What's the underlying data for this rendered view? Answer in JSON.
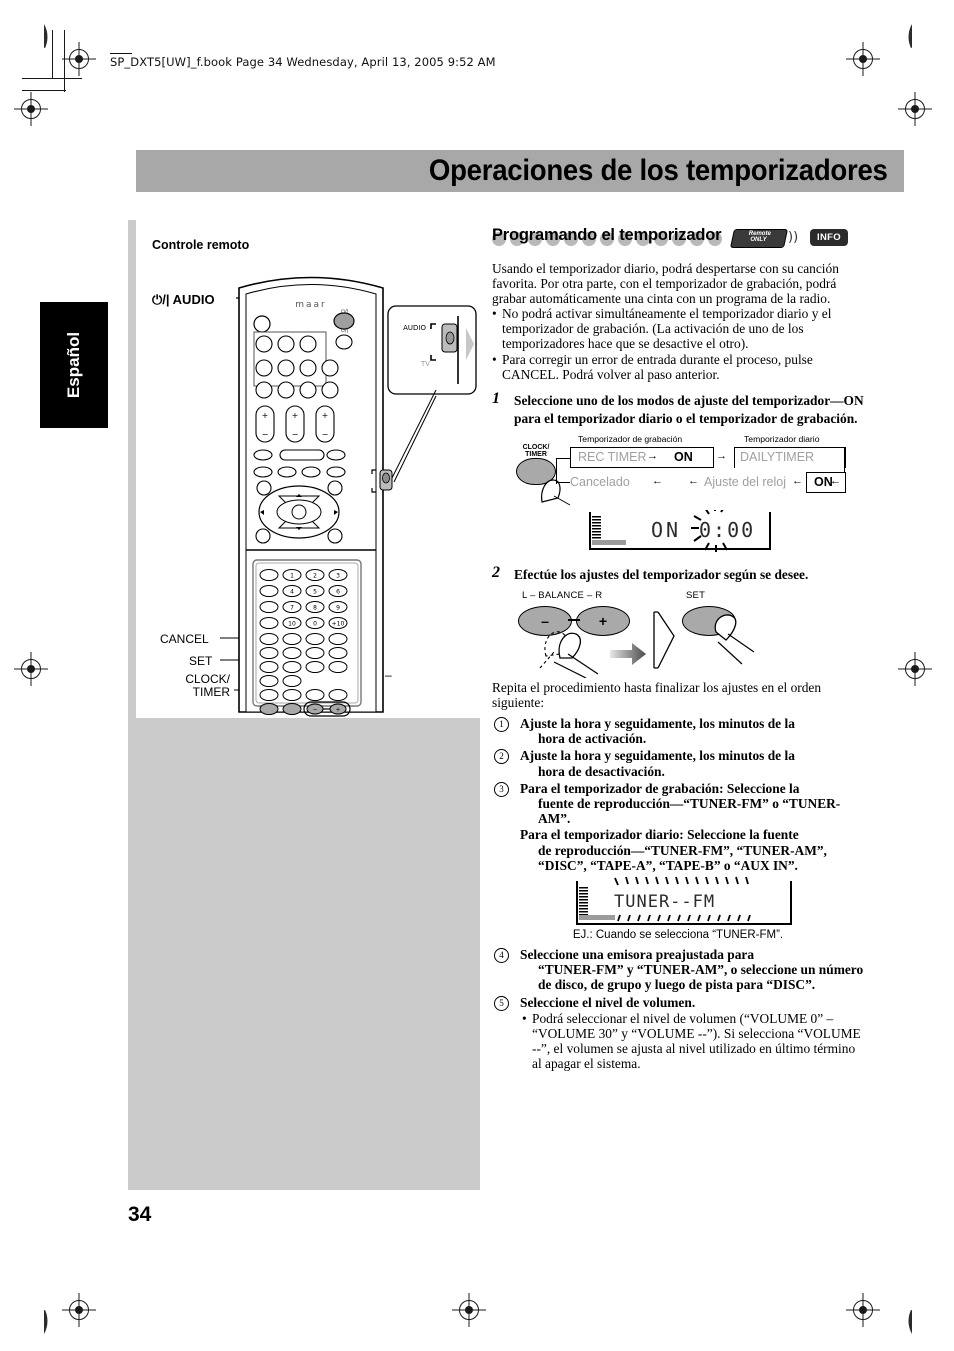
{
  "header": {
    "file_line": "SP_DXT5[UW]_f.book  Page 34  Wednesday, April 13, 2005  9:52 AM"
  },
  "page": {
    "title": "Operaciones de los temporizadores",
    "number": "34",
    "language_tab": "Español"
  },
  "left_panel": {
    "caption": "Controle remoto",
    "brand": "maar",
    "callouts": {
      "power_audio": "⏻/| AUDIO",
      "cancel": "CANCEL",
      "set": "SET",
      "clock_timer": "CLOCK/\nTIMER",
      "clock_timer_l1": "CLOCK/",
      "clock_timer_l2": "TIMER",
      "plus_minus": "+ / –"
    },
    "inset": {
      "audio": "AUDIO",
      "tv": "TV"
    },
    "keypad": [
      "1",
      "2",
      "3",
      "4",
      "5",
      "6",
      "7",
      "8",
      "9",
      "10",
      "0",
      "+10"
    ]
  },
  "section": {
    "heading": "Programando el temporizador",
    "badge_remote_l1": "Remote",
    "badge_remote_l2": "ONLY",
    "badge_info": "INFO",
    "intro": "Usando el temporizador diario, podrá despertarse con su canción favorita. Por otra parte, con el temporizador de grabación, podrá grabar automáticamente una cinta con un programa de la radio.",
    "bullets": [
      "No podrá activar simultáneamente el temporizador diario y el temporizador de grabación. (La activación de uno de los temporizadores hace que se desactive el otro).",
      "Para corregir un error de entrada durante el proceso, pulse CANCEL. Podrá volver al paso anterior."
    ]
  },
  "steps": {
    "one": {
      "num": "1",
      "text": "Seleccione uno de los modos de ajuste del temporizador—ON para el temporizador diario o el temporizador de grabación."
    },
    "two": {
      "num": "2",
      "text": "Efectúe los ajustes del temporizador según se desee."
    }
  },
  "flow": {
    "button_l1": "CLOCK/",
    "button_l2": "TIMER",
    "label_rec": "Temporizador de grabación",
    "label_daily": "Temporizador diario",
    "rec_timer": "REC TIMER",
    "rec_on": "ON",
    "daily_timer": "DAILYTIMER",
    "daily_on": "ON",
    "clock_set": "Ajuste del reloj",
    "cancelled": "Cancelado",
    "arrow": "→"
  },
  "lcd1": {
    "mode": "ON",
    "time": "0:00"
  },
  "lcd2": {
    "source": "TUNER--FM",
    "caption": "EJ.: Cuando se selecciona “TUNER-FM”."
  },
  "art2": {
    "balance_label": "L – BALANCE – R",
    "minus": "–",
    "plus": "+",
    "set_label": "SET"
  },
  "repeat": {
    "lead": "Repita el procedimiento hasta finalizar los ajustes en el orden siguiente:",
    "items": [
      {
        "n": "1",
        "main": "Ajuste la hora y seguidamente, los minutos de la",
        "indent": "hora de activación."
      },
      {
        "n": "2",
        "main": "Ajuste la hora y seguidamente, los minutos de la",
        "indent": "hora de desactivación."
      },
      {
        "n": "3",
        "main": "Para el temporizador de grabación: Seleccione la",
        "indent": "fuente de reproducción—“TUNER-FM” o “TUNER-AM”.",
        "extra": "Para el temporizador diario: Seleccione la fuente",
        "extra_indent": "de reproducción—“TUNER-FM”, “TUNER-AM”, “DISC”, “TAPE-A”, “TAPE-B” o “AUX IN”."
      },
      {
        "n": "4",
        "main": "Seleccione una emisora preajustada para",
        "indent": "“TUNER-FM” y “TUNER-AM”, o seleccione un número de disco, de grupo y luego de pista para “DISC”."
      },
      {
        "n": "5",
        "main": "Seleccione el nivel de volumen.",
        "sub": "Podrá seleccionar el nivel de volumen (“VOLUME 0” – “VOLUME 30” y “VOLUME --”). Si selecciona “VOLUME --”, el volumen se ajusta al nivel utilizado en último término al apagar el sistema."
      }
    ]
  },
  "colors": {
    "title_band": "#a8a8a8",
    "grey_column": "#cbcbcb",
    "button_grey": "#a9a9a9",
    "flow_grey_text": "#a0a0a0"
  }
}
